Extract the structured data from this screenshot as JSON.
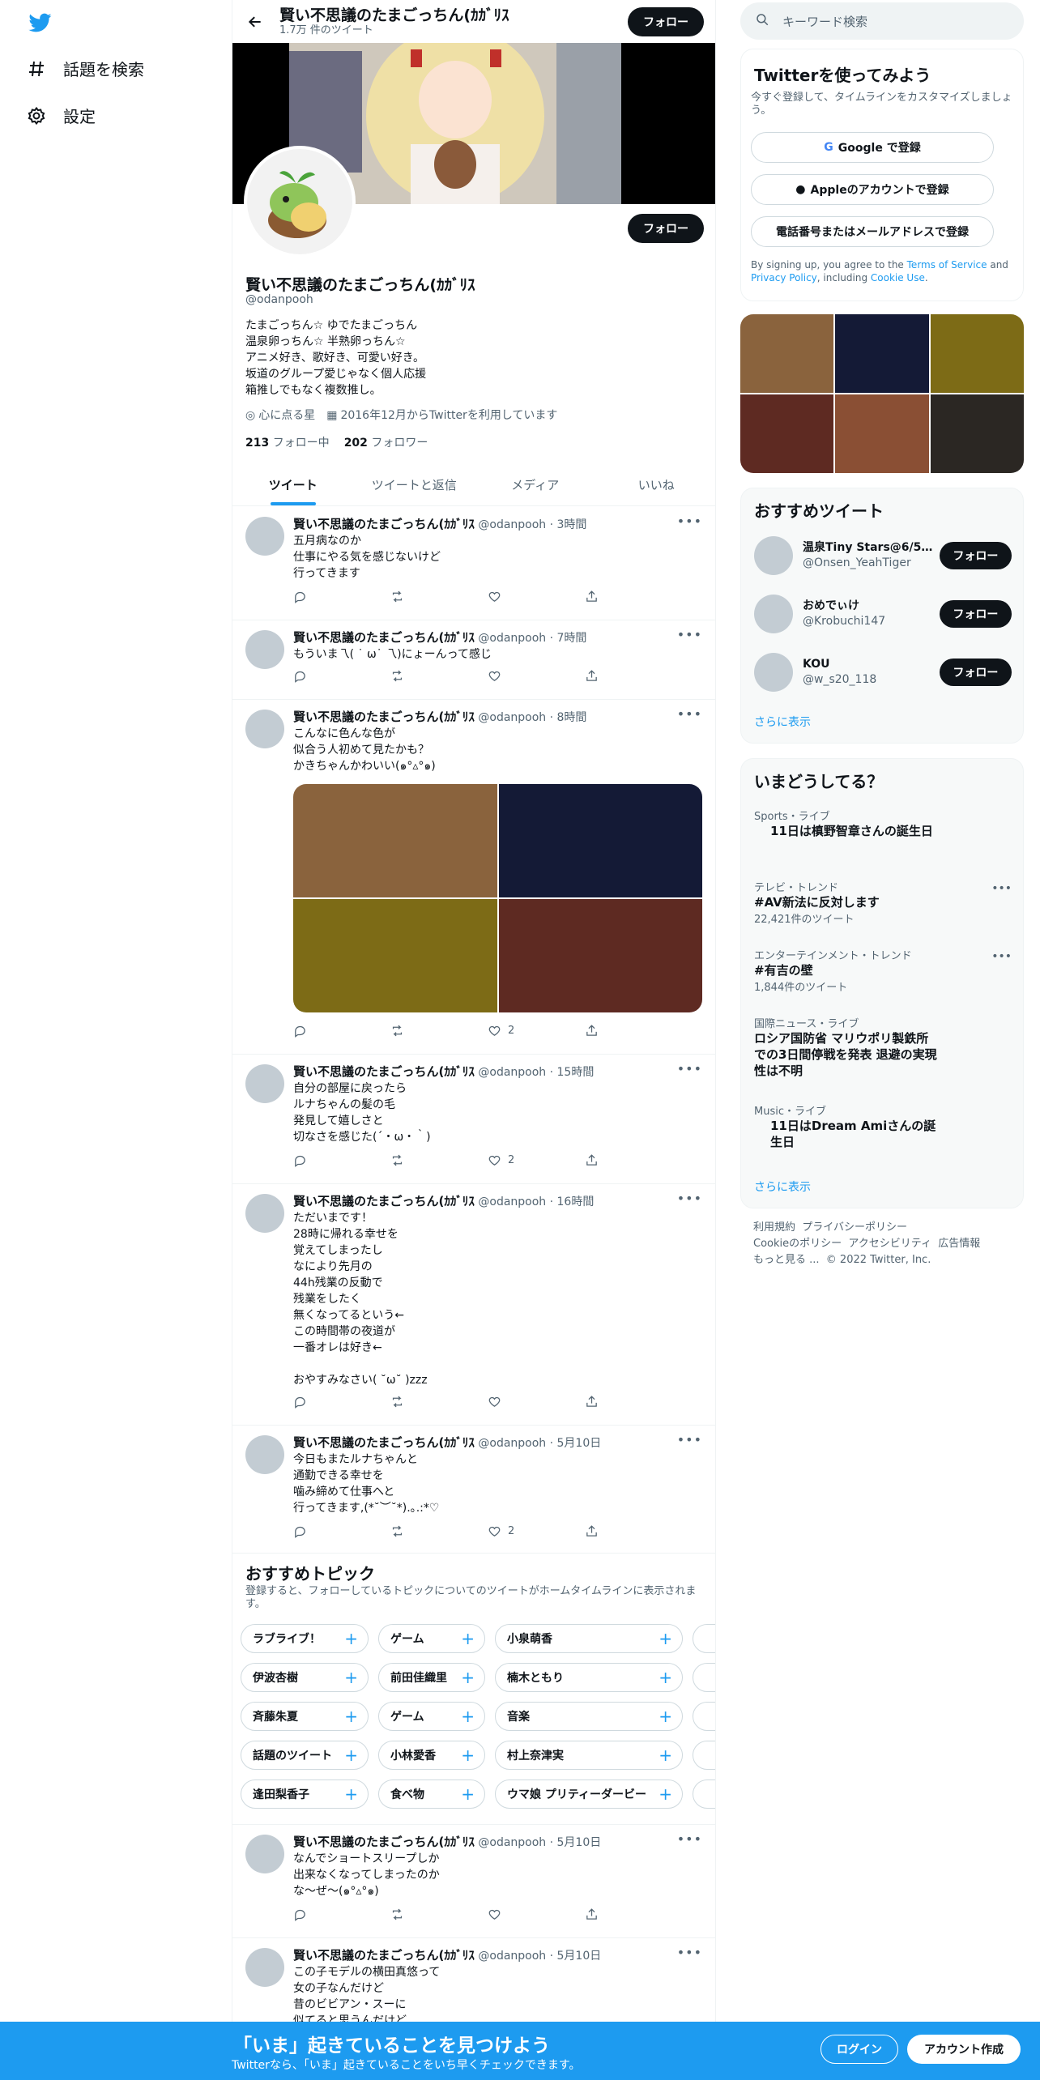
{
  "nav": {
    "explore_label": "話題を検索",
    "settings_label": "設定"
  },
  "header": {
    "name": "賢い不思議のたまごっちん(ｶｶﾞﾘｽ",
    "tweet_count": "1.7万 件のツイート",
    "follow_label": "フォロー"
  },
  "profile": {
    "name": "賢い不思議のたまごっちん(ｶｶﾞﾘｽ",
    "handle": "@odanpooh",
    "bio": "たまごっちん☆ ゆでたまごっちん\n温泉卵っちん☆ 半熟卵っちん☆\nアニメ好き、歌好き、可愛い好き。\n坂道のグループ愛じゃなく個人応援\n箱推しでもなく複数推し。",
    "location": "心に点る星",
    "joined": "2016年12月からTwitterを利用しています",
    "following_count": "213",
    "following_label": "フォロー中",
    "followers_count": "202",
    "followers_label": "フォロワー",
    "follow_label": "フォロー"
  },
  "tabs": [
    "ツイート",
    "ツイートと返信",
    "メディア",
    "いいね"
  ],
  "tweets": [
    {
      "name": "賢い不思議のたまごっちん(ｶｶﾞﾘｽ",
      "handle": "@odanpooh",
      "time": "· 3時間",
      "text": "五月病なのか\n仕事にやる気を感じないけど\n行ってきます",
      "likes": ""
    },
    {
      "name": "賢い不思議のたまごっちん(ｶｶﾞﾘｽ",
      "handle": "@odanpooh",
      "time": "· 7時間",
      "text": "もういま乁( ˙ ω˙ 乁)にょーんって感じ",
      "likes": ""
    },
    {
      "name": "賢い不思議のたまごっちん(ｶｶﾞﾘｽ",
      "handle": "@odanpooh",
      "time": "· 8時間",
      "text": "こんなに色んな色が\n似合う人初めて見たかも？\nかきちゃんかわいい(๑°▵°๑)",
      "likes": "2"
    },
    {
      "name": "賢い不思議のたまごっちん(ｶｶﾞﾘｽ",
      "handle": "@odanpooh",
      "time": "· 15時間",
      "text": "自分の部屋に戻ったら\nルナちゃんの髪の毛\n発見して嬉しさと\n切なさを感じた(´・ω・｀)",
      "likes": "2"
    },
    {
      "name": "賢い不思議のたまごっちん(ｶｶﾞﾘｽ",
      "handle": "@odanpooh",
      "time": "· 16時間",
      "text": "ただいまです！\n28時に帰れる幸せを\n覚えてしまったし\nなにより先月の\n44h残業の反動で\n残業をしたく\n無くなってるという←\nこの時間帯の夜道が\n一番オレは好き←\n\nおやすみなさい( ˘ω˘ )zzz",
      "likes": ""
    },
    {
      "name": "賢い不思議のたまごっちん(ｶｶﾞﾘｽ",
      "handle": "@odanpooh",
      "time": "· 5月10日",
      "text": "今日もまたルナちゃんと\n通勤できる幸せを\n噛み締めて仕事へと\n行ってきます,(*˘︶˘*).｡.:*♡",
      "likes": "2"
    },
    {
      "name": "賢い不思議のたまごっちん(ｶｶﾞﾘｽ",
      "handle": "@odanpooh",
      "time": "· 5月10日",
      "text": "なんでショートスリープしか\n出来なくなってしまったのか\nな〜ぜ〜(๑°▵°๑)",
      "likes": ""
    },
    {
      "name": "賢い不思議のたまごっちん(ｶｶﾞﾘｽ",
      "handle": "@odanpooh",
      "time": "· 5月10日",
      "text": "この子モデルの横田真悠って\n女の子なんだけど\n昔のビビアン・スーに\n似てると思うんだけど",
      "likes": ""
    }
  ],
  "topics": {
    "title": "おすすめトピック",
    "subtitle": "登録すると、フォローしているトピックについてのツイートがホームタイムラインに表示されます。",
    "rows": [
      [
        "ラブライブ！",
        "ゲーム",
        "小泉萌香"
      ],
      [
        "伊波杏樹",
        "前田佳織里",
        "楠木ともり"
      ],
      [
        "斉藤朱夏",
        "ゲーム",
        "音楽"
      ],
      [
        "話題のツイート",
        "小林愛香",
        "村上奈津実"
      ],
      [
        "逢田梨香子",
        "食べ物",
        "ウマ娘 プリティーダービー"
      ]
    ]
  },
  "right": {
    "search_placeholder": "キーワード検索",
    "signup": {
      "title": "Twitterを使ってみよう",
      "desc": "今すぐ登録して、タイムラインをカスタマイズしましょう。",
      "google": "Google で登録",
      "apple": "Appleのアカウントで登録",
      "phone": "電話番号またはメールアドレスで登録",
      "terms_prefix": "By signing up, you agree to the ",
      "terms_link": "Terms of Service",
      "terms_and": " and ",
      "privacy_link": "Privacy Policy",
      "terms_including": ", including ",
      "cookie_link": "Cookie Use",
      "terms_end": "."
    },
    "suggest": {
      "title": "おすすめツイート",
      "users": [
        {
          "name": "温泉Tiny Stars@6/5L...",
          "handle": "@Onsen_YeahTiger"
        },
        {
          "name": "おめでぃけ",
          "handle": "@Krobuchi147"
        },
        {
          "name": "KOU",
          "handle": "@w_s20_118"
        }
      ],
      "follow_label": "フォロー",
      "more": "さらに表示"
    },
    "trends": {
      "title": "いまどうしてる？",
      "items": [
        {
          "cat": "Sports・ライブ",
          "title": "11日は槙野智章さんの誕生日",
          "count": ""
        },
        {
          "cat": "テレビ・トレンド",
          "title": "#AV新法に反対します",
          "count": "22,421件のツイート"
        },
        {
          "cat": "エンターテインメント・トレンド",
          "title": "#有吉の壁",
          "count": "1,844件のツイート"
        },
        {
          "cat": "国際ニュース・ライブ",
          "title": "ロシア国防省 マリウポリ製鉄所での3日間停戦を発表 退避の実現性は不明",
          "count": ""
        },
        {
          "cat": "Music・ライブ",
          "title": "11日はDream Amiさんの誕生日",
          "count": ""
        }
      ],
      "more": "さらに表示"
    },
    "footer": {
      "terms": "利用規約",
      "privacy": "プライバシーポリシー",
      "cookie": "Cookieのポリシー",
      "access": "アクセシビリティ",
      "ads": "広告情報",
      "more": "もっと見る ...",
      "copy": "© 2022 Twitter, Inc."
    }
  },
  "bottom": {
    "title": "「いま」起きていることを見つけよう",
    "subtitle": "Twitterなら、「いま」起きていることをいち早くチェックできます。",
    "login": "ログイン",
    "signup": "アカウント作成"
  },
  "colors": {
    "accent": "#1d9bf0",
    "palette": [
      "#8a633d",
      "#141a36",
      "#7d6b16",
      "#5e2a22",
      "#8a4f34",
      "#2b2723"
    ]
  }
}
